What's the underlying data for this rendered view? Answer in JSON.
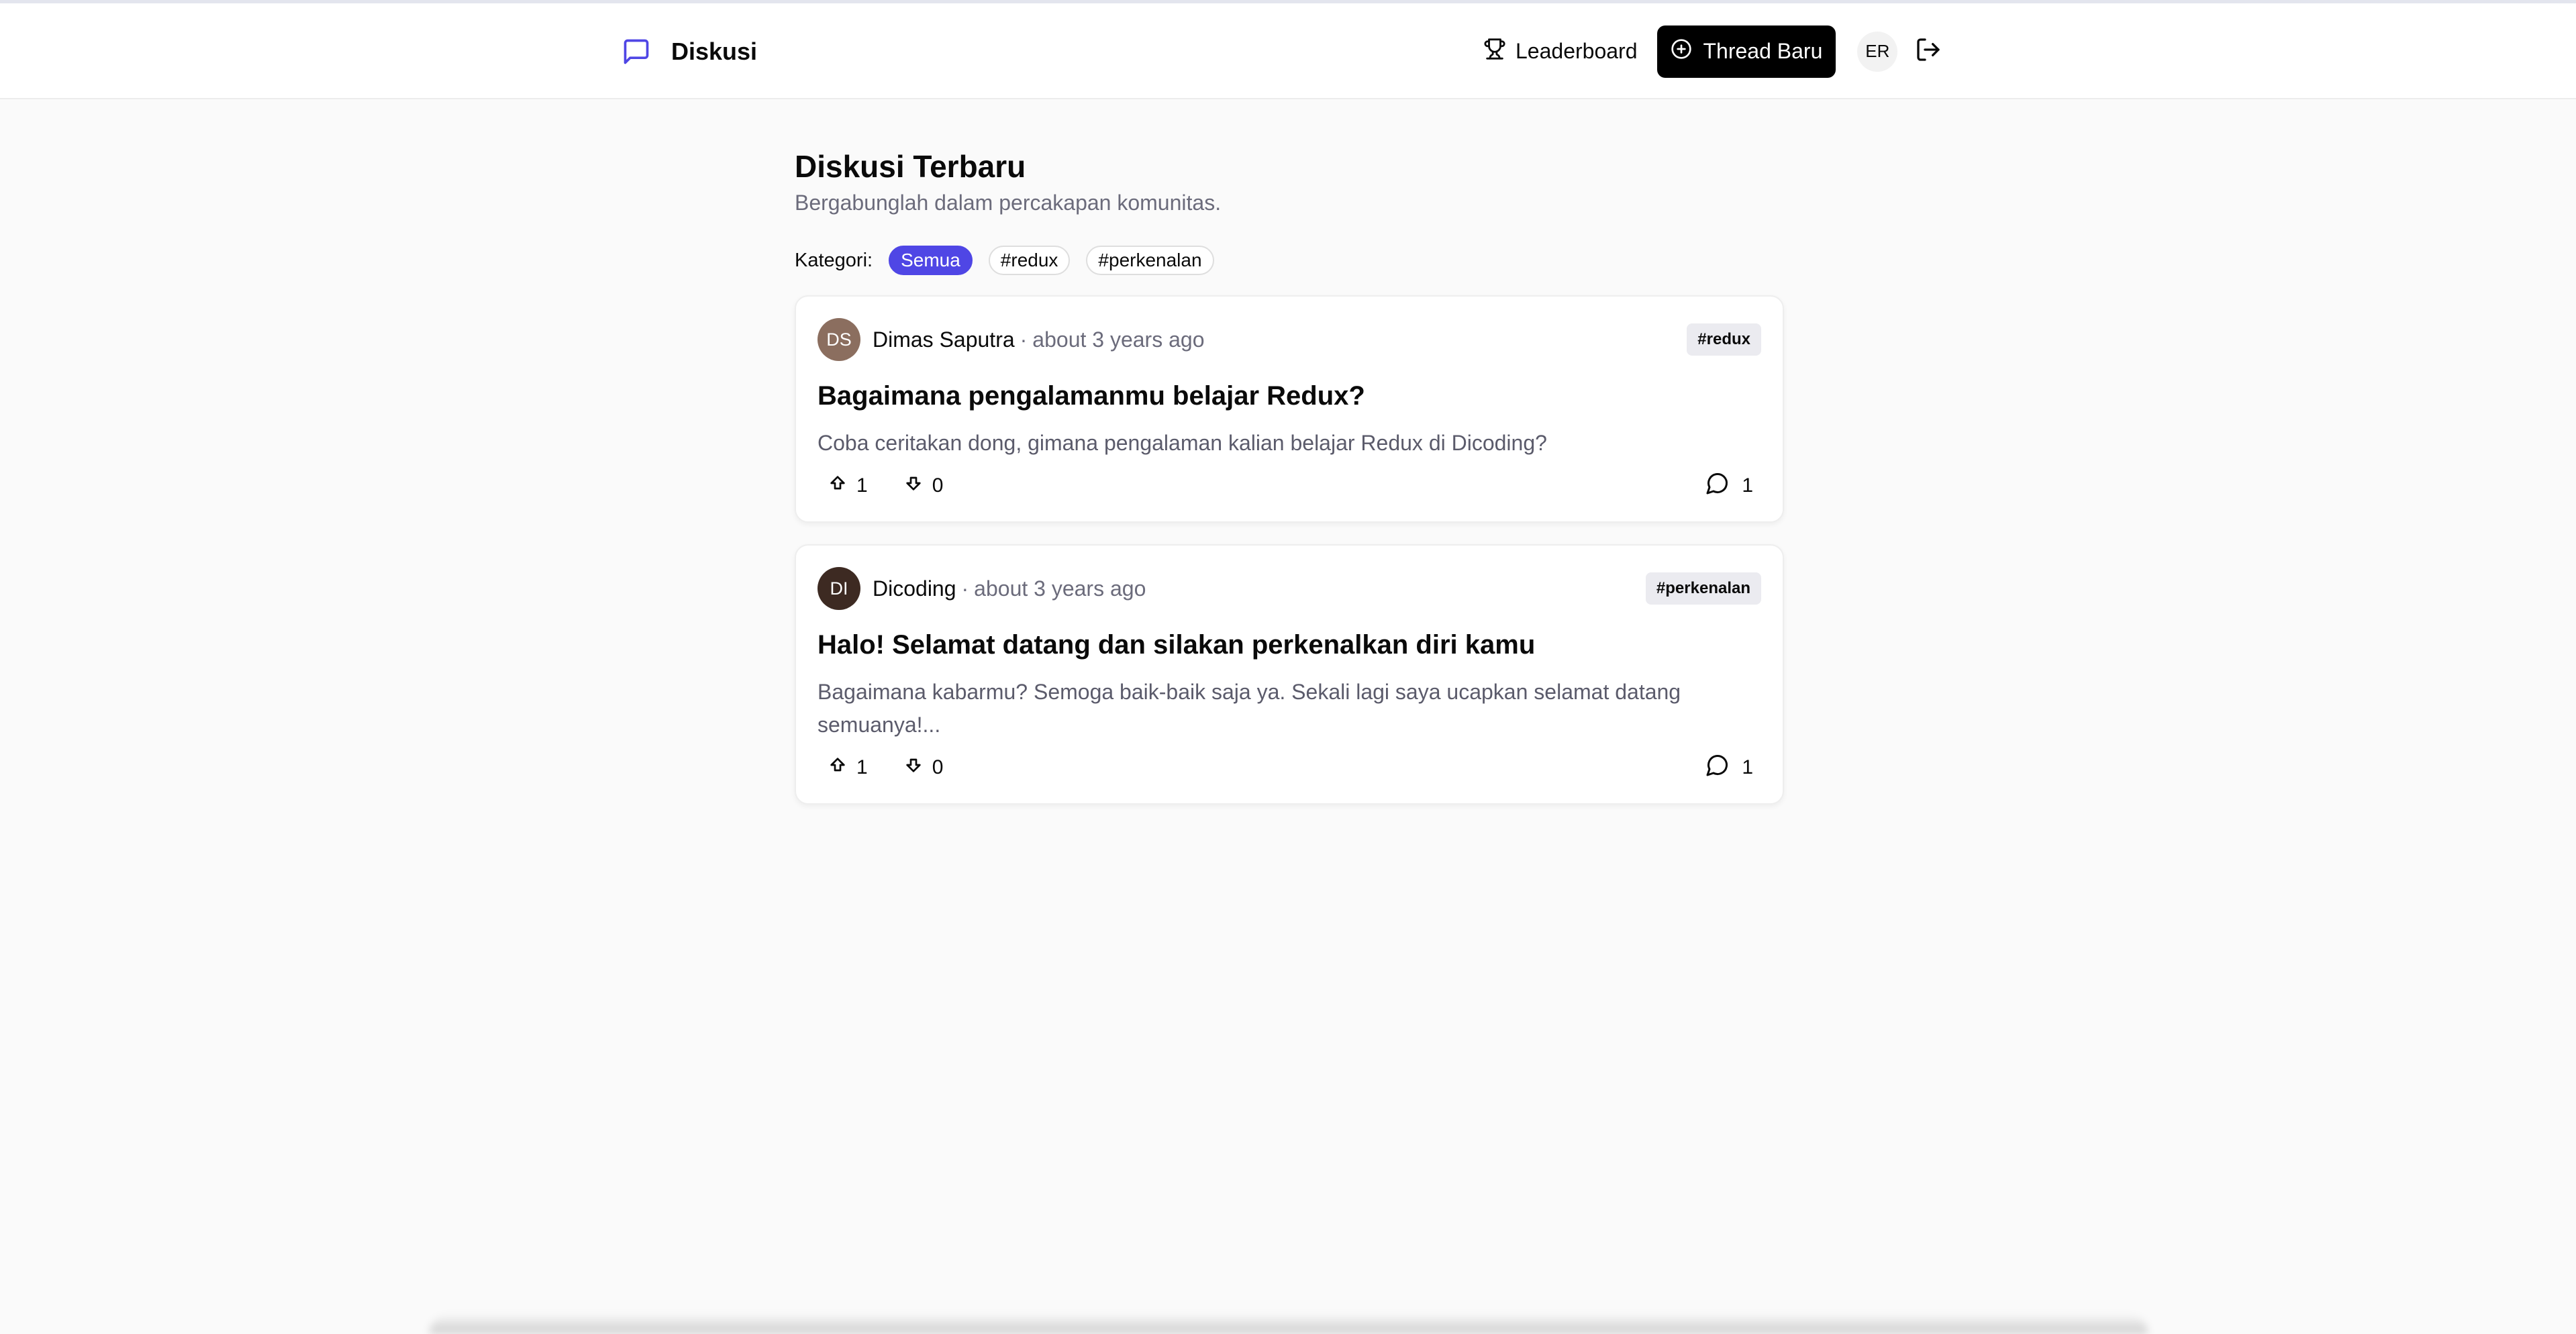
{
  "app": {
    "name": "Diskusi"
  },
  "nav": {
    "leaderboard_label": "Leaderboard",
    "new_thread_label": "Thread Baru",
    "user_initials": "ER"
  },
  "page": {
    "title": "Diskusi Terbaru",
    "subtitle": "Bergabunglah dalam percakapan komunitas."
  },
  "categories": {
    "label": "Kategori:",
    "items": [
      {
        "label": "Semua",
        "active": true
      },
      {
        "label": "#redux",
        "active": false
      },
      {
        "label": "#perkenalan",
        "active": false
      }
    ]
  },
  "threads": [
    {
      "initials": "DS",
      "avatar_color": "#8b6e5f",
      "author": "Dimas Saputra",
      "time": "about 3 years ago",
      "category": "#redux",
      "title": "Bagaimana pengalamanmu belajar Redux?",
      "body": "Coba ceritakan dong, gimana pengalaman kalian belajar Redux di Dicoding?",
      "upvotes": "1",
      "downvotes": "0",
      "comments": "1"
    },
    {
      "initials": "DI",
      "avatar_color": "#3d2a22",
      "author": "Dicoding",
      "time": "about 3 years ago",
      "category": "#perkenalan",
      "title": "Halo! Selamat datang dan silakan perkenalkan diri kamu",
      "body": "Bagaimana kabarmu? Semoga baik-baik saja ya. Sekali lagi saya ucapkan selamat datang semuanya!...",
      "upvotes": "1",
      "downvotes": "0",
      "comments": "1"
    }
  ],
  "colors": {
    "accent": "#4f46e5",
    "background": "#fafafa",
    "primary_button": "#000000"
  }
}
